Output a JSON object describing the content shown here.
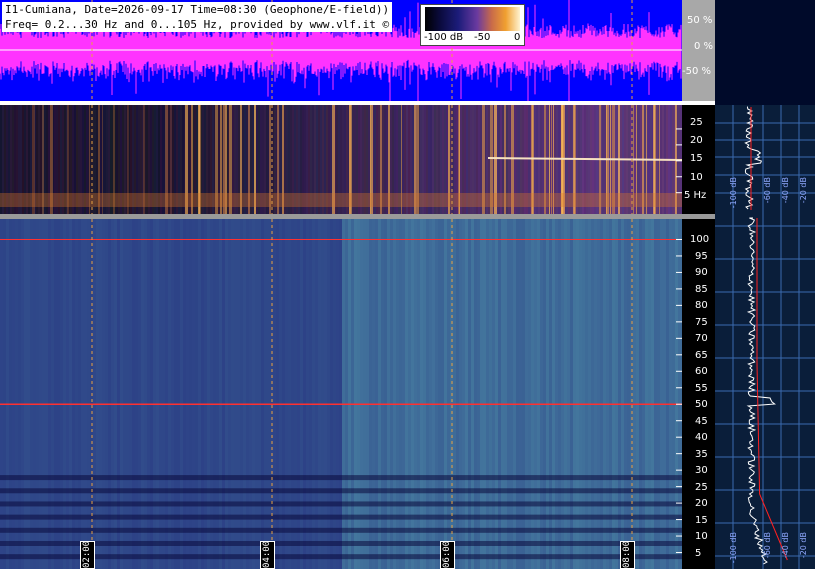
{
  "header": {
    "title_line1": "I1-Cumiana, Date=2026-09-17 Time=08:30 (Geophone/E-field))",
    "title_line2": "Freq= 0.2...30 Hz and 0...105 Hz, provided by www.vlf.it ©"
  },
  "colorbar": {
    "labels": [
      "-100 dB",
      "-50",
      "0"
    ]
  },
  "colors": {
    "waveform_bg": "#0000ff",
    "waveform_trace": "#ff33ff",
    "waveform_zero": "#ffffff",
    "grid_line": "#e8a040",
    "mains_line": "#ff3030",
    "profile_trace": "#ffffff",
    "profile_mean": "#ff2020"
  },
  "chart_data": [
    {
      "type": "line",
      "name": "waveform",
      "yticks": [
        "50 %",
        "0 %",
        "-50 %"
      ],
      "ylim": [
        -100,
        100
      ]
    },
    {
      "type": "heatmap",
      "name": "geophone-spectrogram",
      "yunit": "Hz",
      "yticks": [
        "25",
        "20",
        "15",
        "10",
        "5 Hz"
      ],
      "ylim": [
        0.2,
        30
      ],
      "xticks": [
        "02:00",
        "04:00",
        "06:00",
        "08:00"
      ],
      "profile_xticks": [
        "-100 dB",
        "-60 dB",
        "-40 dB",
        "-20 dB"
      ]
    },
    {
      "type": "heatmap",
      "name": "efield-spectrogram",
      "yticks": [
        "100",
        "95",
        "90",
        "85",
        "80",
        "75",
        "70",
        "65",
        "60",
        "55",
        "50",
        "45",
        "40",
        "35",
        "30",
        "25",
        "20",
        "15",
        "10",
        "5"
      ],
      "ylim": [
        0,
        105
      ],
      "xticks": [
        "02:00",
        "04:00",
        "06:00",
        "08:00"
      ],
      "profile_xticks": [
        "-100 dB",
        "-60 dB",
        "-40 dB",
        "-20 dB"
      ]
    }
  ]
}
